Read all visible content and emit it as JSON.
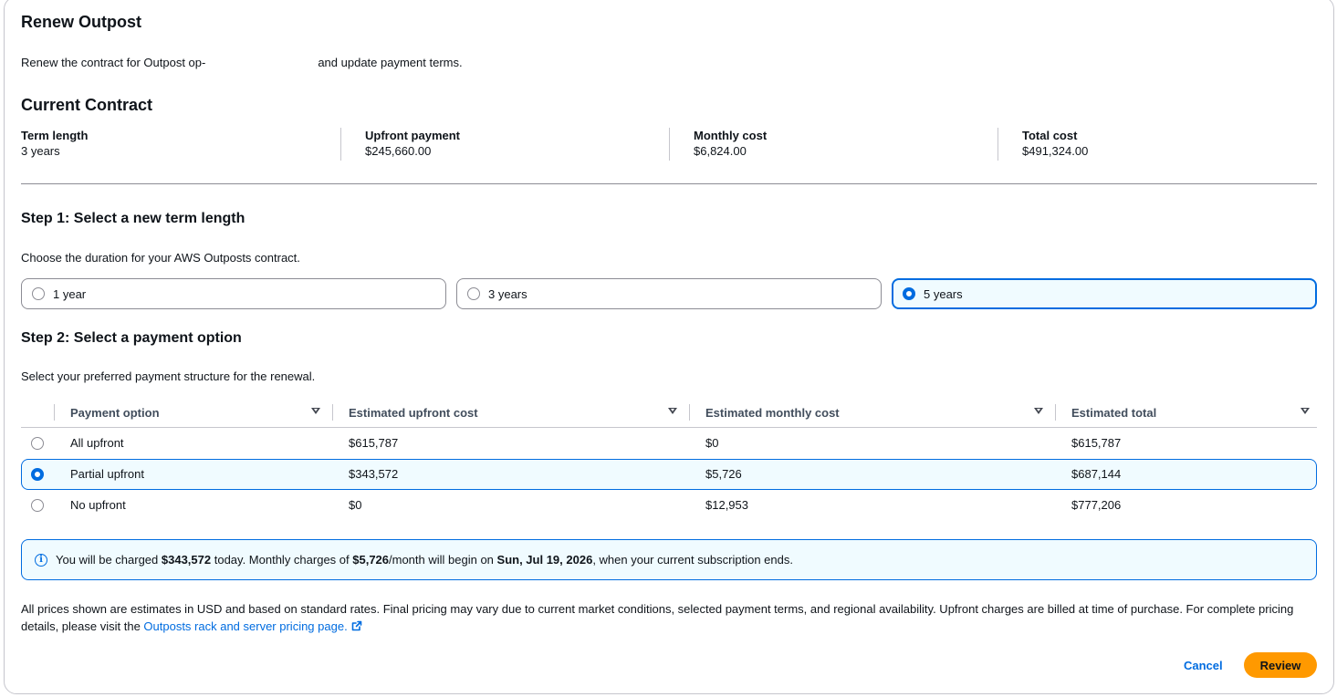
{
  "modal": {
    "title": "Renew Outpost",
    "description_before": "Renew the contract for Outpost op-",
    "description_after": "and update payment terms."
  },
  "current_contract": {
    "title": "Current Contract",
    "items": [
      {
        "label": "Term length",
        "value": "3 years"
      },
      {
        "label": "Upfront payment",
        "value": "$245,660.00"
      },
      {
        "label": "Monthly cost",
        "value": "$6,824.00"
      },
      {
        "label": "Total cost",
        "value": "$491,324.00"
      }
    ]
  },
  "step1": {
    "title": "Step 1: Select a new term length",
    "description": "Choose the duration for your AWS Outposts contract.",
    "options": [
      {
        "label": "1 year",
        "selected": false
      },
      {
        "label": "3 years",
        "selected": false
      },
      {
        "label": "5 years",
        "selected": true
      }
    ]
  },
  "step2": {
    "title": "Step 2: Select a payment option",
    "description": "Select your preferred payment structure for the renewal.",
    "columns": [
      "Payment option",
      "Estimated upfront cost",
      "Estimated monthly cost",
      "Estimated total"
    ],
    "rows": [
      {
        "option": "All upfront",
        "upfront": "$615,787",
        "monthly": "$0",
        "total": "$615,787",
        "selected": false
      },
      {
        "option": "Partial upfront",
        "upfront": "$343,572",
        "monthly": "$5,726",
        "total": "$687,144",
        "selected": true
      },
      {
        "option": "No upfront",
        "upfront": "$0",
        "monthly": "$12,953",
        "total": "$777,206",
        "selected": false
      }
    ]
  },
  "alert": {
    "t1": "You will be charged ",
    "b1": "$343,572",
    "t2": " today. Monthly charges of ",
    "b2": "$5,726",
    "t3": "/month will begin on ",
    "b3": "Sun, Jul 19, 2026",
    "t4": ", when your current subscription ends."
  },
  "footnote": {
    "text": "All prices shown are estimates in USD and based on standard rates. Final pricing may vary due to current market conditions, selected payment terms, and regional availability. Upfront charges are billed at time of purchase. For complete pricing details, please visit the ",
    "link": "Outposts rack and server pricing page."
  },
  "actions": {
    "cancel": "Cancel",
    "review": "Review"
  },
  "colors": {
    "accent": "#006ce0",
    "primary_button": "#ff9900",
    "selected_bg": "#f0fbff"
  }
}
